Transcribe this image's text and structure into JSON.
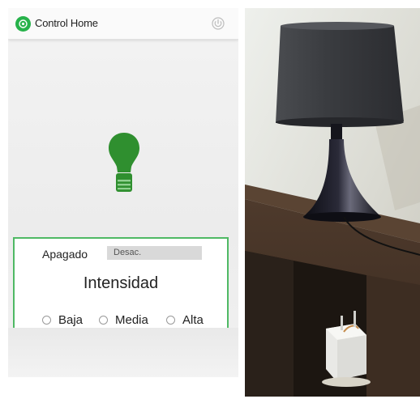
{
  "app": {
    "title": "Control Home",
    "logo_icon": "app-logo-icon",
    "power_icon": "power-icon"
  },
  "lamp": {
    "icon": "lightbulb-icon",
    "color": "#2f8f2f"
  },
  "status": {
    "label": "Apagado",
    "field_value": "Desac."
  },
  "intensity": {
    "title": "Intensidad",
    "options": [
      {
        "label": "Baja",
        "selected": false
      },
      {
        "label": "Media",
        "selected": false
      },
      {
        "label": "Alta",
        "selected": false
      }
    ]
  },
  "colors": {
    "accent": "#26b24a",
    "panel_border": "#4fb964"
  }
}
